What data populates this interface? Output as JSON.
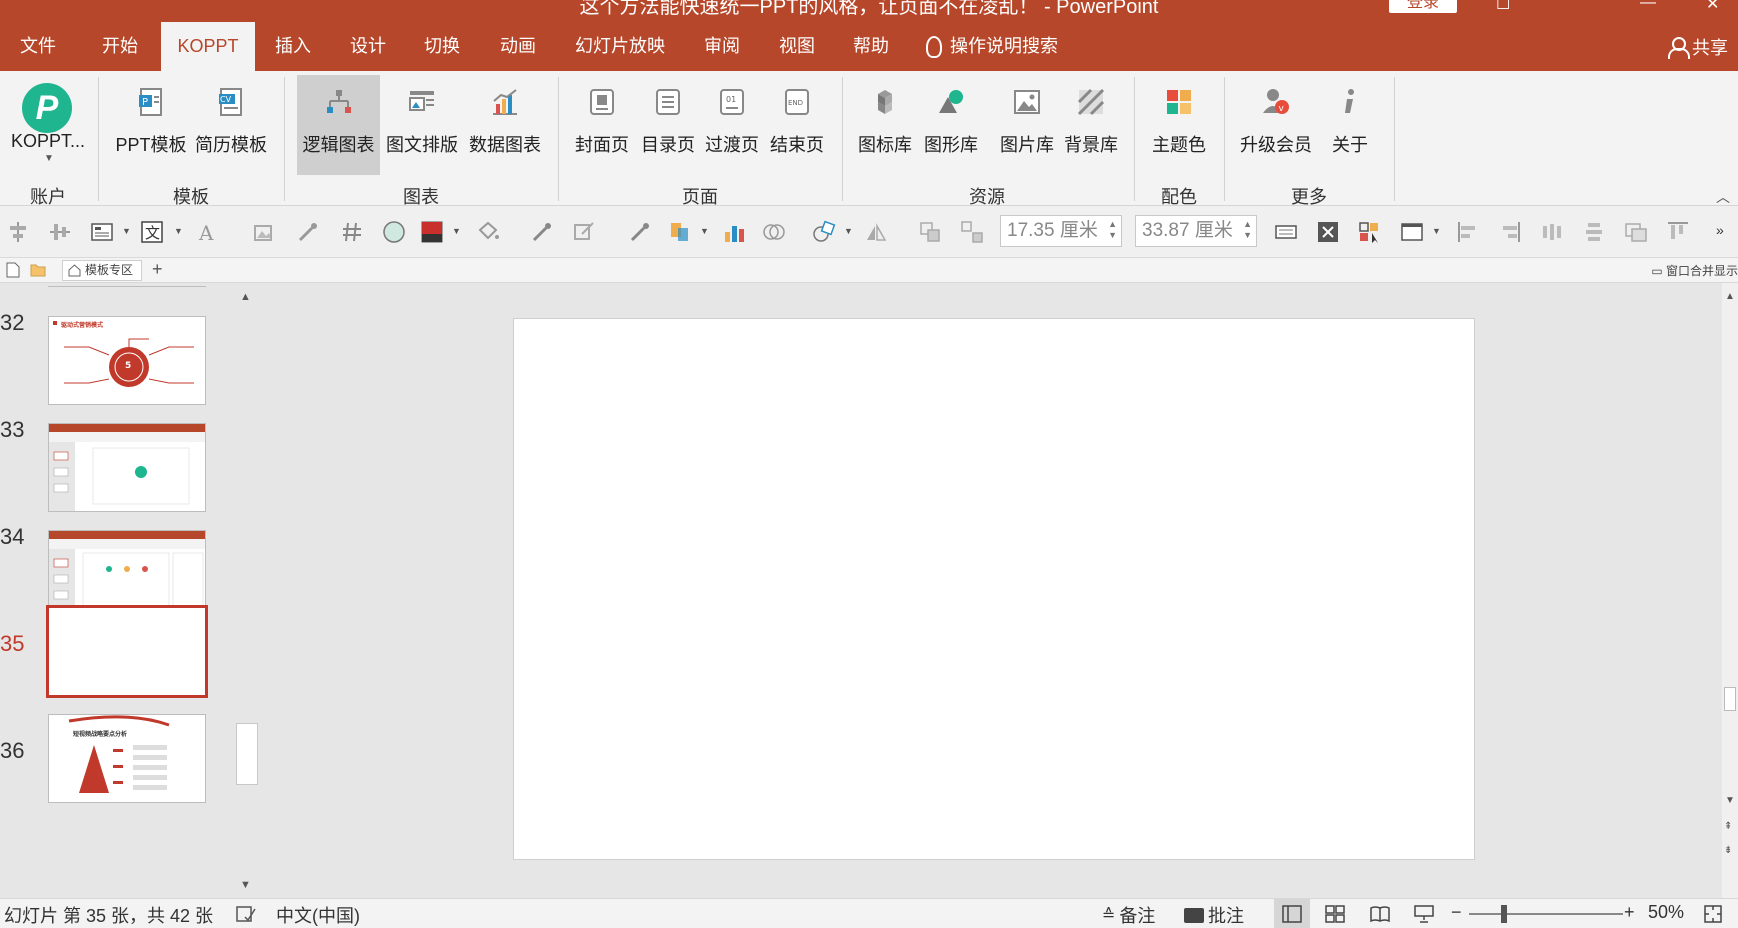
{
  "window": {
    "title": "这个方法能快速统一PPT的风格，让页面不在凌乱！ - PowerPoint",
    "login_label": "登录",
    "min_glyph": "—",
    "max_glyph": "☐",
    "close_glyph": "✕"
  },
  "tabs": {
    "file": "文件",
    "home": "开始",
    "koppt": "KOPPT",
    "insert": "插入",
    "design": "设计",
    "transitions": "切换",
    "animations": "动画",
    "slideshow": "幻灯片放映",
    "review": "审阅",
    "view": "视图",
    "help": "帮助",
    "search": "操作说明搜索",
    "share": "共享"
  },
  "ribbon": {
    "account": {
      "label": "KOPPT...",
      "group": "账户",
      "logo_letter": "P"
    },
    "templates": {
      "ppt": "PPT模板",
      "resume": "简历模板",
      "group": "模板"
    },
    "charts": {
      "logic": "逻辑图表",
      "layout": "图文排版",
      "data": "数据图表",
      "group": "图表"
    },
    "pages": {
      "cover": "封面页",
      "toc": "目录页",
      "transition": "过渡页",
      "end": "结束页",
      "group": "页面"
    },
    "resources": {
      "icons": "图标库",
      "shapes": "图形库",
      "pictures": "图片库",
      "backgrounds": "背景库",
      "group": "资源"
    },
    "color": {
      "theme": "主题色",
      "group": "配色"
    },
    "more": {
      "upgrade": "升级会员",
      "about": "关于",
      "group": "更多"
    }
  },
  "toolbar": {
    "height_value": "17.35 厘米",
    "width_value": "33.87 厘米"
  },
  "tabstrip": {
    "home_label": "模板专区",
    "merge_label": "窗口合并显示"
  },
  "thumbnails": {
    "items": [
      {
        "number": "32",
        "caption": "驱动式营销模式"
      },
      {
        "number": "33"
      },
      {
        "number": "34"
      },
      {
        "number": "35"
      },
      {
        "number": "36",
        "caption": "短视频战略要点分析"
      }
    ]
  },
  "statusbar": {
    "slide_info": "幻灯片 第 35 张，共 42 张",
    "language": "中文(中国)",
    "notes": "备注",
    "comments": "批注",
    "zoom": "50%"
  },
  "colors": {
    "accent": "#b7472a",
    "logo": "#1fb58f",
    "current_slide": "#c0392b"
  }
}
